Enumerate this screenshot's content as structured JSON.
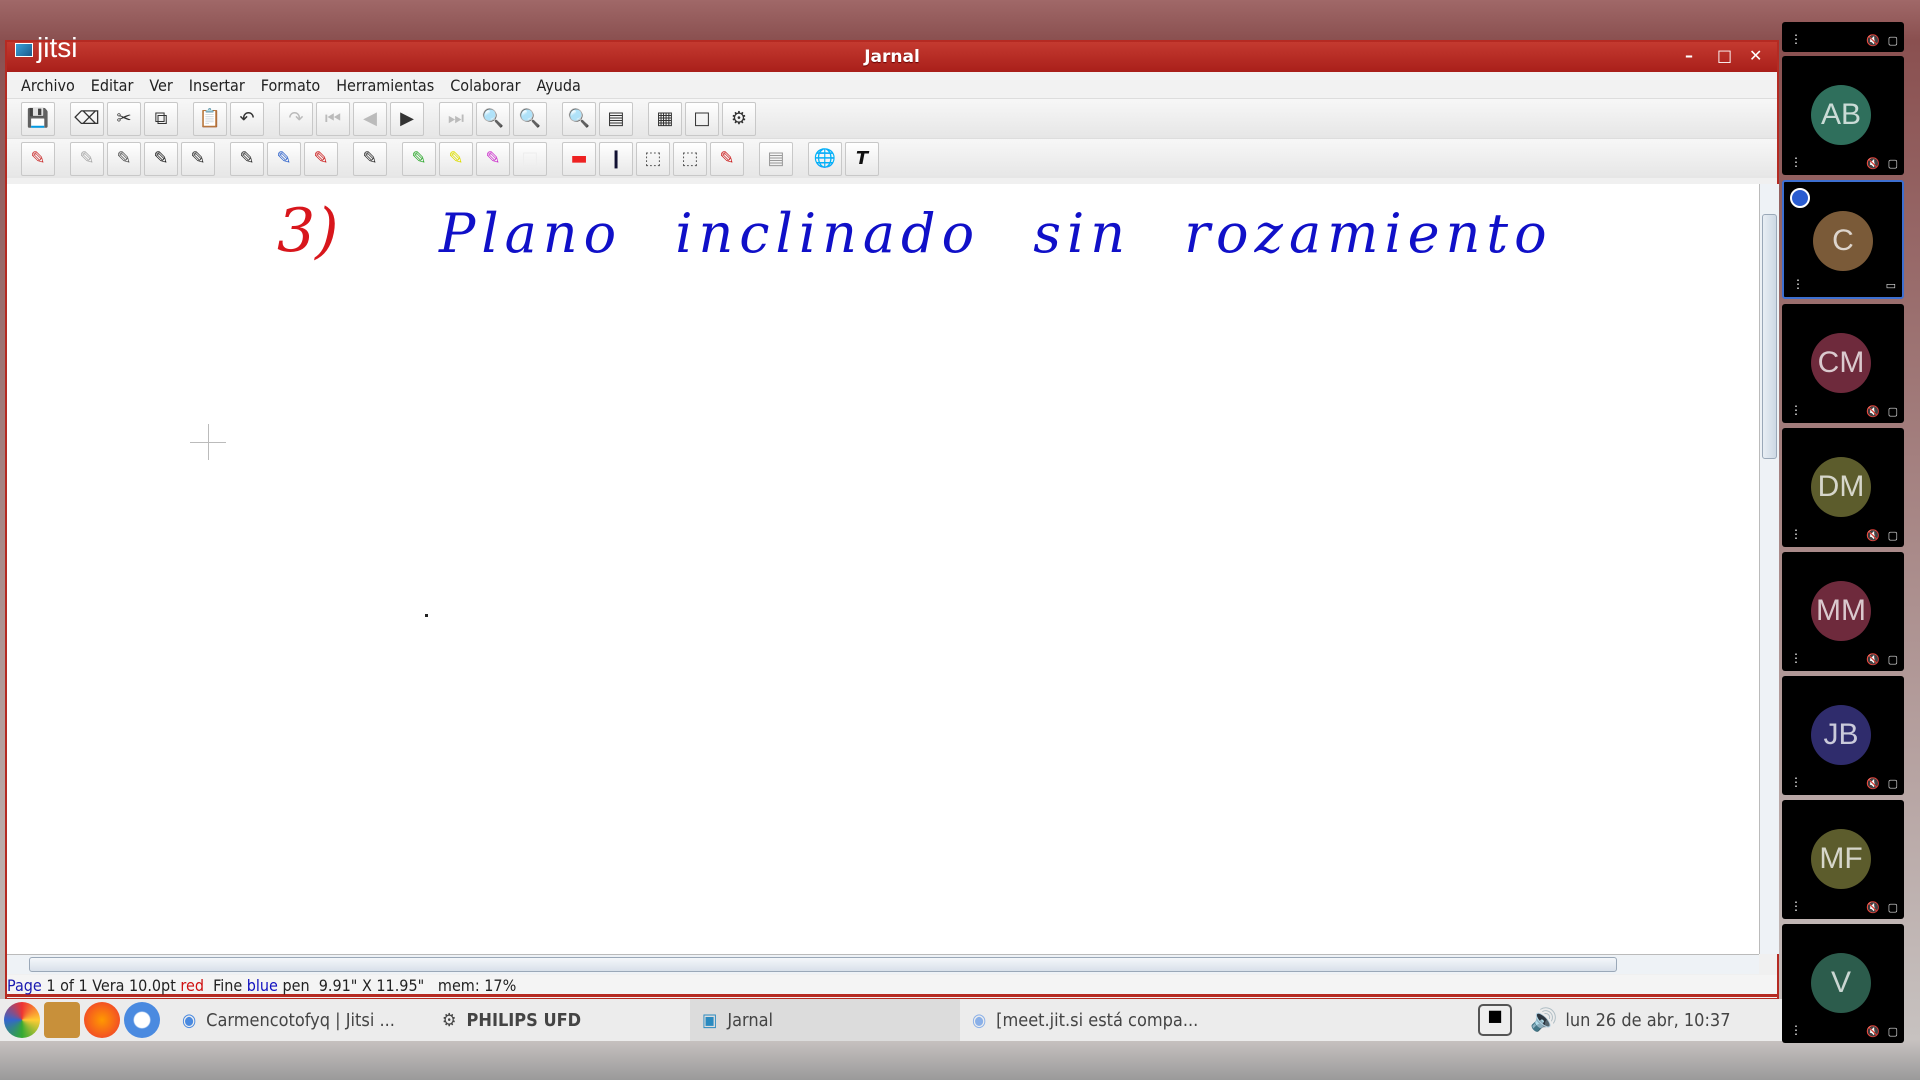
{
  "window": {
    "title": "Jarnal",
    "logo": "jitsi"
  },
  "menu": [
    "Archivo",
    "Editar",
    "Ver",
    "Insertar",
    "Formato",
    "Herramientas",
    "Colaborar",
    "Ayuda"
  ],
  "toolbar1": [
    "save-icon",
    "eraser-icon",
    "cut-icon",
    "copy-icon",
    "paste-icon",
    "undo-icon",
    "redo-icon",
    "first-page-icon",
    "prev-page-icon",
    "next-page-icon",
    "last-page-icon",
    "zoom-in-icon",
    "zoom-out-icon",
    "zoom-fit-icon",
    "single-page-icon",
    "grid-pages-icon",
    "new-page-icon",
    "refresh-icon"
  ],
  "canvas": {
    "number_label": "3)",
    "text": "Plano inclinado sin rozamiento",
    "red": "#d8161c",
    "blue": "#1010c8"
  },
  "status": {
    "page_word": "Page",
    "page_info": " 1 of 1 Vera 10.0pt ",
    "color1": "red",
    "mid": "  Fine ",
    "color2": "blue",
    "rest": " pen  9.91\" X 11.95\"   mem: 17%"
  },
  "taskbar": {
    "items": [
      "Carmencotofyq | Jitsi ...",
      "PHILIPS UFD",
      "Jarnal",
      "[meet.jit.si está compa..."
    ],
    "clock": "lun 26 de abr, 10:37"
  },
  "participants": [
    {
      "initials": "AB",
      "color": "#2f6f5c"
    },
    {
      "initials": "C",
      "color": "#7a5a38",
      "active": true
    },
    {
      "initials": "CM",
      "color": "#6e2a3c"
    },
    {
      "initials": "DM",
      "color": "#5c5c2c"
    },
    {
      "initials": "MM",
      "color": "#6e2a3c"
    },
    {
      "initials": "JB",
      "color": "#2f2c6c"
    },
    {
      "initials": "MF",
      "color": "#5c5c2c"
    },
    {
      "initials": "V",
      "color": "#2c5c4c"
    }
  ]
}
